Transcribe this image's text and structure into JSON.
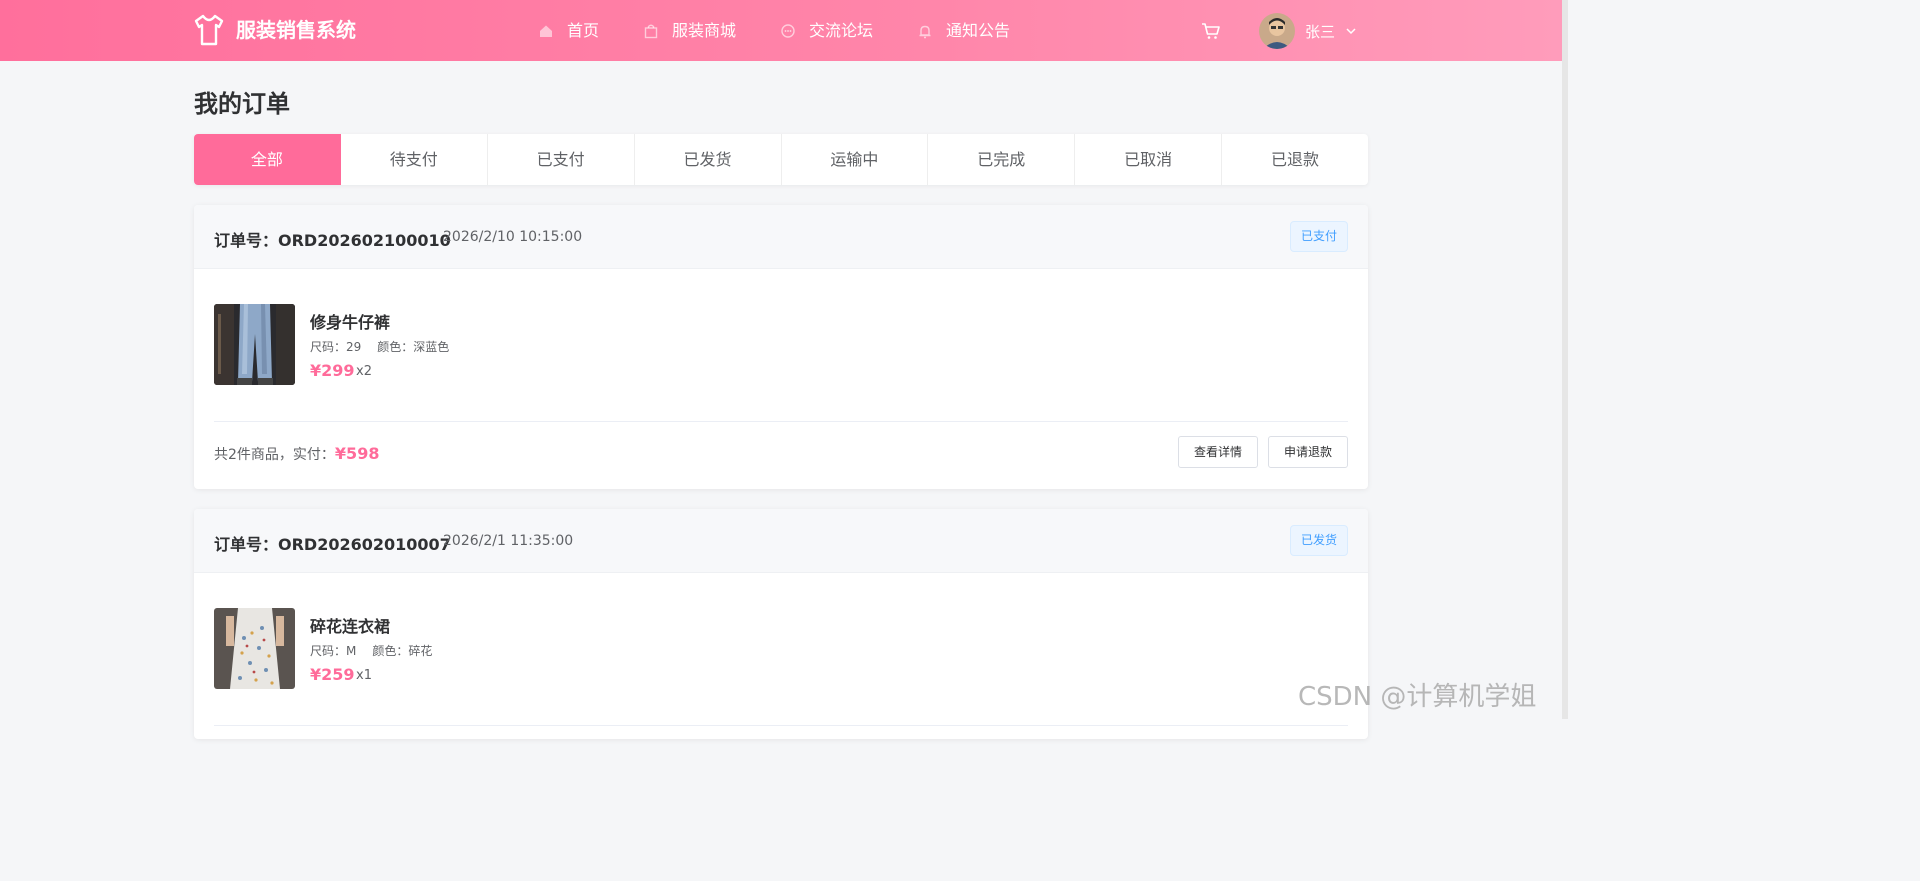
{
  "app": {
    "title": "服装销售系统"
  },
  "nav": [
    {
      "label": "首页",
      "icon": "home-icon"
    },
    {
      "label": "服装商城",
      "icon": "shopping-bag-icon"
    },
    {
      "label": "交流论坛",
      "icon": "chat-bubble-icon"
    },
    {
      "label": "通知公告",
      "icon": "bell-icon"
    }
  ],
  "user": {
    "name": "张三"
  },
  "page": {
    "title": "我的订单"
  },
  "tabs": [
    "全部",
    "待支付",
    "已支付",
    "已发货",
    "运输中",
    "已完成",
    "已取消",
    "已退款"
  ],
  "active_tab": "全部",
  "orders": [
    {
      "order_no": "订单号：ORD202602100010",
      "time": "2026/2/10 10:15:00",
      "status": "已支付",
      "product": {
        "name": "修身牛仔裤",
        "size": "尺码：29",
        "color": "颜色：深蓝色",
        "price": "¥299",
        "qty": "x2"
      },
      "summary_prefix": "共2件商品，实付：",
      "summary_amount": "¥598",
      "buttons": {
        "detail": "查看详情",
        "refund": "申请退款"
      }
    },
    {
      "order_no": "订单号：ORD202602010007",
      "time": "2026/2/1 11:35:00",
      "status": "已发货",
      "product": {
        "name": "碎花连衣裙",
        "size": "尺码：M",
        "color": "颜色：碎花",
        "price": "¥259",
        "qty": "x1"
      }
    }
  ],
  "watermark": "CSDN @计算机学姐",
  "colors": {
    "brand": "#ff6b9a",
    "status_blue": "#409eff"
  }
}
